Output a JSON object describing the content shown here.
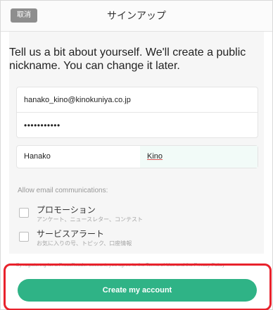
{
  "header": {
    "cancel_label": "取消",
    "title": "サインアップ"
  },
  "intro_text": "Tell us a bit about yourself. We'll create a public nickname. You can change it later.",
  "account": {
    "email_value": "hanako_kino@kinokuniya.co.jp",
    "password_value": "•••••••••••"
  },
  "name": {
    "first_value": "Hanako",
    "last_value": "Kino"
  },
  "email_comms": {
    "label": "Allow email communications:",
    "options": [
      {
        "title": "プロモーション",
        "subtitle": "アンケート、ニュースレター、コンテスト",
        "checked": false
      },
      {
        "title": "サービスアラート",
        "subtitle": "お気に入りの号、トピック、口座情報",
        "checked": false
      }
    ]
  },
  "terms_text": "By registering for a PressReader account, you agree to the Terms of Use and the Privacy Policy",
  "create_button_label": "Create my account",
  "colors": {
    "accent": "#2fb386",
    "highlight": "#e8222c",
    "cancel_button": "#8e8e8e"
  }
}
